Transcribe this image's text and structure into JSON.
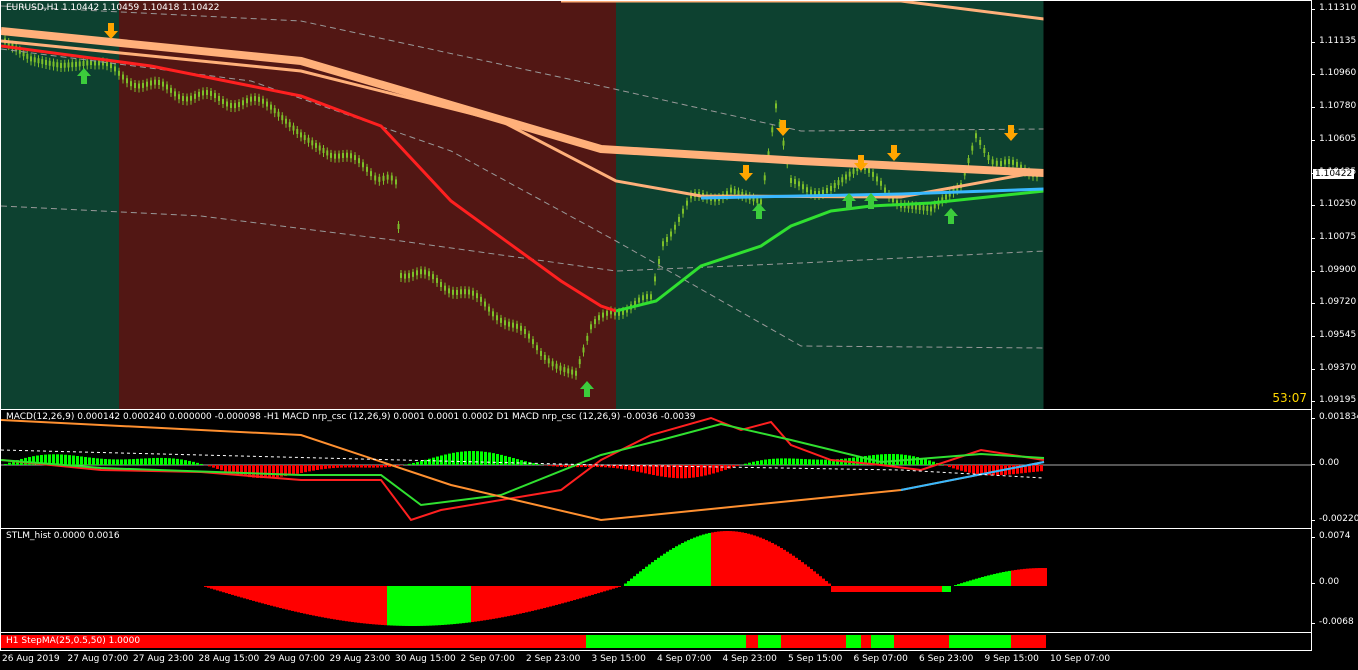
{
  "main": {
    "symbol_label": "EURUSD,H1  1.10442 1.10459 1.10418 1.10422",
    "timer": "53:07",
    "current_price": "1.10422",
    "price_ticks": [
      "1.11310",
      "1.11135",
      "1.10960",
      "1.10780",
      "1.10605",
      "1.10425",
      "1.10250",
      "1.10075",
      "1.09900",
      "1.09720",
      "1.09545",
      "1.09370",
      "1.09195"
    ]
  },
  "macd": {
    "label": "MACD(12,26,9) 0.000142 0.000240 0.000000 -0.000098 -H1 MACD nrp_csc (12,26,9) 0.0001 0.0001 0.0002  D1 MACD nrp_csc (12,26,9) -0.0036 -0.0039",
    "ticks": [
      "0.001834",
      "0.00",
      "-0.002207"
    ]
  },
  "stlm": {
    "label": "STLM_hist 0.0000 0.0016",
    "ticks": [
      "0.0074",
      "0.00",
      "-0.0068"
    ]
  },
  "stepma": {
    "label": "H1 StepMA(25,0.5,50) 1.0000"
  },
  "time_axis": [
    "26 Aug 2019",
    "27 Aug 07:00",
    "27 Aug 23:00",
    "28 Aug 15:00",
    "29 Aug 07:00",
    "29 Aug 23:00",
    "30 Aug 15:00",
    "2 Sep 07:00",
    "2 Sep 23:00",
    "3 Sep 15:00",
    "4 Sep 07:00",
    "4 Sep 23:00",
    "5 Sep 15:00",
    "6 Sep 07:00",
    "6 Sep 23:00",
    "9 Sep 15:00",
    "10 Sep 07:00"
  ],
  "colors": {
    "bull_bg": "#0d4130",
    "bear_bg": "#521714",
    "candle": "#7cbf2a",
    "ma_red": "#ff2020",
    "ma_orange": "#ffb07a",
    "ma_green": "#30e030",
    "ma_blue": "#38b8ff",
    "arrow_up": "#3ccc3c",
    "arrow_down": "#ffa500",
    "hist_red": "#ff0000",
    "hist_green": "#00ff00"
  }
}
